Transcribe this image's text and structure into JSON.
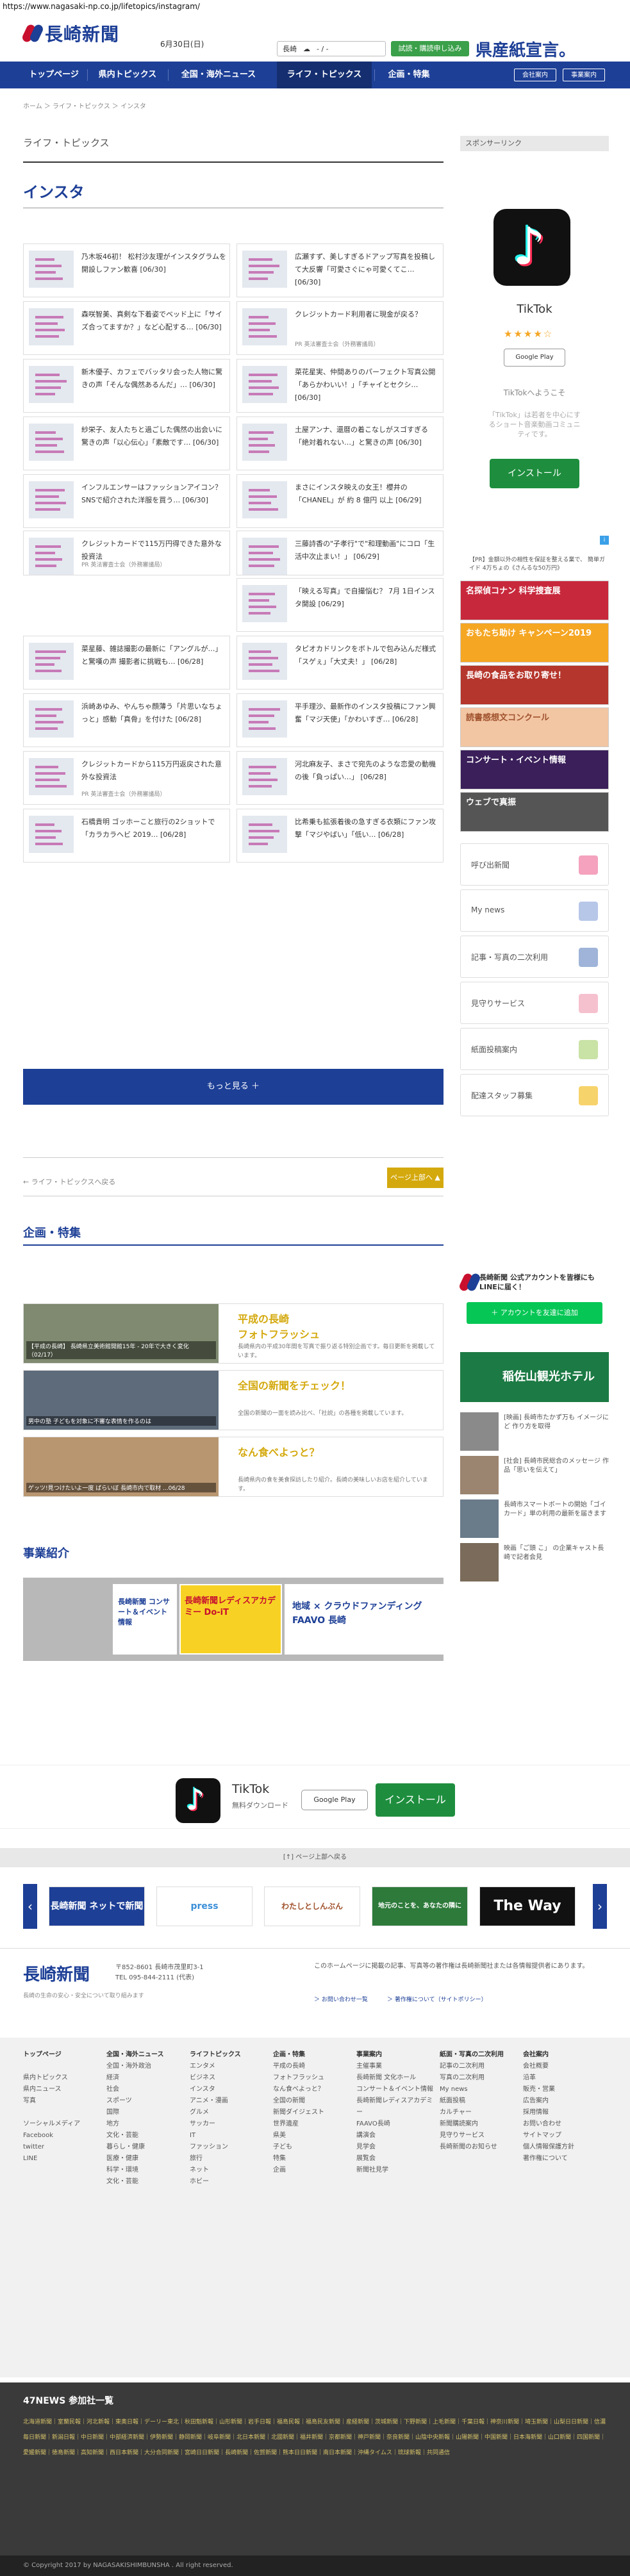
{
  "url": "https://www.nagasaki-np.co.jp/lifetopics/instagram/",
  "header": {
    "logo": "長崎新聞",
    "date": "6月30日(日)",
    "weather_city": "長崎",
    "weather_temp": "- / -",
    "trial_button": "試読・購読申し込み",
    "sangyo": "県産紙宣言。"
  },
  "nav": {
    "items": [
      "トップページ",
      "県内トピックス",
      "全国・海外ニュース",
      "ライフ・トピックス",
      "企画・特集"
    ],
    "login": "会社案内",
    "contact": "事業案内"
  },
  "breadcrumb": "ホーム ＞ ライフ・トピックス ＞ インスタ",
  "section": "ライフ・トピックス",
  "page_title": "インスタ",
  "articles": [
    {
      "title": "乃木坂46初！ 松村沙友理がインスタグラムを開設しファン歓喜 [06/30]",
      "pr": ""
    },
    {
      "title": "広瀬すず、美しすぎるドアップ写真を投稿して大反響「可愛さぐにゃ可愛くてこ… [06/30]",
      "pr": ""
    },
    {
      "title": "森咲智美、真剣な下着姿でベッド上に「サイズ合ってますか？」など心配する… [06/30]",
      "pr": ""
    },
    {
      "title": "クレジットカード利用者に現金が戻る？",
      "pr": "PR 英法審査士会（外務審議局）"
    },
    {
      "title": "新木優子、カフェでバッタリ会った人物に驚きの声「そんな偶然あるんだ」… [06/30]",
      "pr": ""
    },
    {
      "title": "菜花星実、仲間ありのパーフェクト写真公開「あらかわいい！」「チャイとセクシ… [06/30]",
      "pr": ""
    },
    {
      "title": "紗栄子、友人たちと過ごした偶然の出会いに驚きの声「以心伝心」「素敵です… [06/30]",
      "pr": ""
    },
    {
      "title": "土屋アンナ、還暦の着こなしがスゴすぎる「絶対着れない…」と驚きの声 [06/30]",
      "pr": ""
    },
    {
      "title": "インフルエンサーはファッションアイコン？ SNSで紹介された洋服を買う… [06/30]",
      "pr": ""
    },
    {
      "title": "まさにインスタ映えの女王！櫻井の「CHANEL」が 約 8 億円 以上 [06/29]",
      "pr": ""
    },
    {
      "title": "クレジットカードで115万円得できた意外な投資法",
      "pr": "PR 英法審査士会（外務審議局）"
    },
    {
      "title": "三藤詩香の\"子孝行\"で\"和理動画\"にコロ「生活中次止まい！」 [06/29]",
      "pr": ""
    },
    {
      "title": "",
      "pr": ""
    },
    {
      "title": "「映える写真」で自撮悩む？ 7月 1日インスタ開設 [06/29]",
      "pr": ""
    },
    {
      "title": "菜星藤、雑誌撮影の最新に「アングルが…」と驚嘆の声 撮影者に挑戦も… [06/28]",
      "pr": ""
    },
    {
      "title": "タピオカドリンクをボトルで包み込んだ様式「スゲぇ」「大丈夫！」 [06/28]",
      "pr": ""
    },
    {
      "title": "浜崎あゆみ、やんちゃ顔薄う「片思いなちょっと」感動「真骨」を付けた [06/28]",
      "pr": ""
    },
    {
      "title": "平手理沙、最新作のインスタ投稿にファン興奮「マジ天使」「かわいすぎ… [06/28]",
      "pr": ""
    },
    {
      "title": "クレジットカードから115万円返戻された意外な投資法",
      "pr": "PR 英法審査士会（外務審議局）"
    },
    {
      "title": "河北麻友子、まさで宛先のような恋愛の動機の後「負っぱい…」 [06/28]",
      "pr": ""
    },
    {
      "title": "石橋貴明 ゴッホーこと旅行の2ショットで「カラカラヘビ 2019… [06/28]",
      "pr": ""
    },
    {
      "title": "比希乗も拡張着後の急すぎる衣類にファン攻撃「マジやばい」「低い… [06/28]",
      "pr": ""
    }
  ],
  "more_button": "もっと見る ＋",
  "back_link": "← ライフ・トピックスへ戻る",
  "page_top": "ページ上部へ ▲",
  "kikaku": {
    "title": "企画・特集",
    "items": [
      {
        "caption": "【平成の長崎】 長崎県立美術館開館15年 - 20年で大きく変化（02/17）",
        "heading": "平成の長崎\nフォトフラッシュ",
        "desc": "長崎県内の平成30年間を写真で振り返る特別企画です。毎日更新を掲載しています。"
      },
      {
        "caption": "男中の塾 子どもを対象に不審な表情を作るのは",
        "heading": "全国の新聞をチェック！",
        "desc": "全国の新聞の一面を読み比べ、「社説」の各種を掲載しています。"
      },
      {
        "caption": "ゲッツ!見つけたいよ一度 ばらいぼ 長崎市内で取材 ...06/28",
        "heading": "なん食べよっと？",
        "desc": "長崎県内の食を美食探訪したり紹介。長崎の美味しいお店を紹介しています。"
      }
    ]
  },
  "jigyo": {
    "title": "事業紹介",
    "banners": [
      "長崎新聞 コンサート＆イベント情報",
      "長崎新聞レディスアカデミー Do-iT",
      "地域 × クラウドファンディング FAAVO 長崎"
    ]
  },
  "sidebar": {
    "sponsor": "スポンサーリンク",
    "ad": {
      "name": "TikTok",
      "stars": "★★★★☆",
      "gplay": "Google Play",
      "welcome": "TikTokへようこそ",
      "desc": "「TikTok」は若者を中心にするショート音楽動画コミュニティです。",
      "install": "インストール"
    },
    "news": "【PR】金額以外の相性を保証を整える業で、 簡単ガイド 4万ちょの《さんるな50万円》",
    "banners": [
      "名探偵コナン 科学捜査展",
      "おもたち助け キャンペーン2019",
      "長崎の食品をお取り寄せ！",
      "読書感想文コンクール",
      "コンサート・イベント情報",
      "ウェブで真振"
    ],
    "menu": [
      "呼び出新聞",
      "My news",
      "記事・写真の二次利用",
      "見守りサービス",
      "紙面投稿案内",
      "配達スタッフ募集"
    ],
    "line_text": "長崎新聞 公式アカウントを皆様にも LINEに届く！",
    "line_button": "＋ アカウントを友達に追加",
    "hotel": "稲佐山観光ホテル",
    "snippets": [
      "[映画] 長崎市たかず万も イメージにど 作り方を取得",
      "[社会] 長崎市民総合のメッセージ 作品「思いを伝えて」",
      "長崎市スマートボートの開始「ゴイカ一ド」単の利用の最新を届きます",
      "映画「ご頭 こ」 の企業キャスト長崎で記者会見"
    ]
  },
  "bottom_ad": {
    "name": "TikTok",
    "sub": "無料ダウンロード",
    "gplay": "Google Play",
    "install": "インストール"
  },
  "page_top_strip": "[↑] ページ上部へ戻る",
  "carousel": [
    "長崎新聞 ネットで新聞",
    "press",
    "わたしとしんぶん",
    "地元のことを、あなたの隣に",
    "The Way"
  ],
  "footer": {
    "logo": "長崎新聞",
    "addr1": "〒852-8601 長崎市茂里町3-1",
    "addr2": "TEL 095-844-2111 (代表)",
    "copy": "長崎の生命の安心・安全について取り組みます",
    "note": "このホームページに掲載の記事、写真等の著作権は長崎新聞社または各情報提供者にあります。",
    "privacy": "＞ お問い合わせ一覧",
    "privacy2": "＞ 著作権について（サイトポリシー）"
  },
  "sitemap": [
    {
      "h": "トップページ",
      "items": [
        "",
        "県内トピックス",
        "県内ニュース",
        "写真",
        "",
        "ソーシャルメディア",
        "Facebook",
        "twitter",
        "LINE"
      ]
    },
    {
      "h": "全国・海外ニュース",
      "items": [
        "全国・海外政治",
        "経済",
        "社会",
        "スポーツ",
        "国際",
        "地方",
        "文化・芸能",
        "暮らし・健康",
        "医療・健康",
        "科学・環境",
        "文化・芸能"
      ]
    },
    {
      "h": "ライフトピックス",
      "items": [
        "エンタメ",
        "ビジネス",
        "インスタ",
        "アニメ・漫画",
        "グルメ",
        "サッカー",
        "IT",
        "ファッション",
        "旅行",
        "ネット",
        "ホビー"
      ]
    },
    {
      "h": "企画・特集",
      "items": [
        "平成の長崎",
        "フォトフラッシュ",
        "なん食べよっと？",
        "全国の新聞",
        "新聞ダイジェスト",
        "世界遺産",
        "県美",
        "子ども",
        "特集",
        "企画"
      ]
    },
    {
      "h": "事業案内",
      "items": [
        "主催事業",
        "長崎新聞 文化ホール",
        "コンサート＆イベント情報",
        "長崎新聞レディスアカデミー",
        "FAAVO長崎",
        "講演会",
        "見学会",
        "展覧会",
        "新聞社見学"
      ]
    },
    {
      "h": "紙面・写真の二次利用",
      "items": [
        "記事の二次利用",
        "写真の二次利用",
        "My news",
        "紙面投稿",
        "カルチャー",
        "新聞購読案内",
        "見守りサービス",
        "長崎新聞のお知らせ"
      ]
    },
    {
      "h": "会社案内",
      "items": [
        "会社概要",
        "沿革",
        "販売・営業",
        "広告案内",
        "採用情報",
        "お問い合わせ",
        "サイトマップ",
        "個人情報保護方針",
        "著作権について"
      ]
    }
  ],
  "n47": {
    "title": "47NEWS 参加社一覧",
    "list": "北海道新聞｜室蘭民報｜河北新報｜東奥日報｜デーリー東北｜秋田魁新報｜山形新聞｜岩手日報｜福島民報｜福島民友新聞｜産経新聞｜茨城新聞｜下野新聞｜上毛新聞｜千葉日報｜神奈川新聞｜埼玉新聞｜山梨日日新聞｜信濃毎日新聞｜新潟日報｜中日新聞｜中部経済新聞｜伊勢新聞｜静岡新聞｜岐阜新聞｜北日本新聞｜北國新聞｜福井新聞｜京都新聞｜神戸新聞｜奈良新聞｜山陰中央新報｜山陽新聞｜中国新聞｜日本海新聞｜山口新聞｜四国新聞｜愛媛新聞｜徳島新聞｜高知新聞｜西日本新聞｜大分合同新聞｜宮崎日日新聞｜長崎新聞｜佐賀新聞｜熊本日日新聞｜南日本新聞｜沖縄タイムス｜琉球新報｜共同通信"
  },
  "copyright": "© Copyright 2017 by NAGASAKISHIMBUNSHA . All right reserved.",
  "colors": {
    "brand": "#1d3f96",
    "accent": "#d4a90e",
    "line": "#06c755"
  }
}
